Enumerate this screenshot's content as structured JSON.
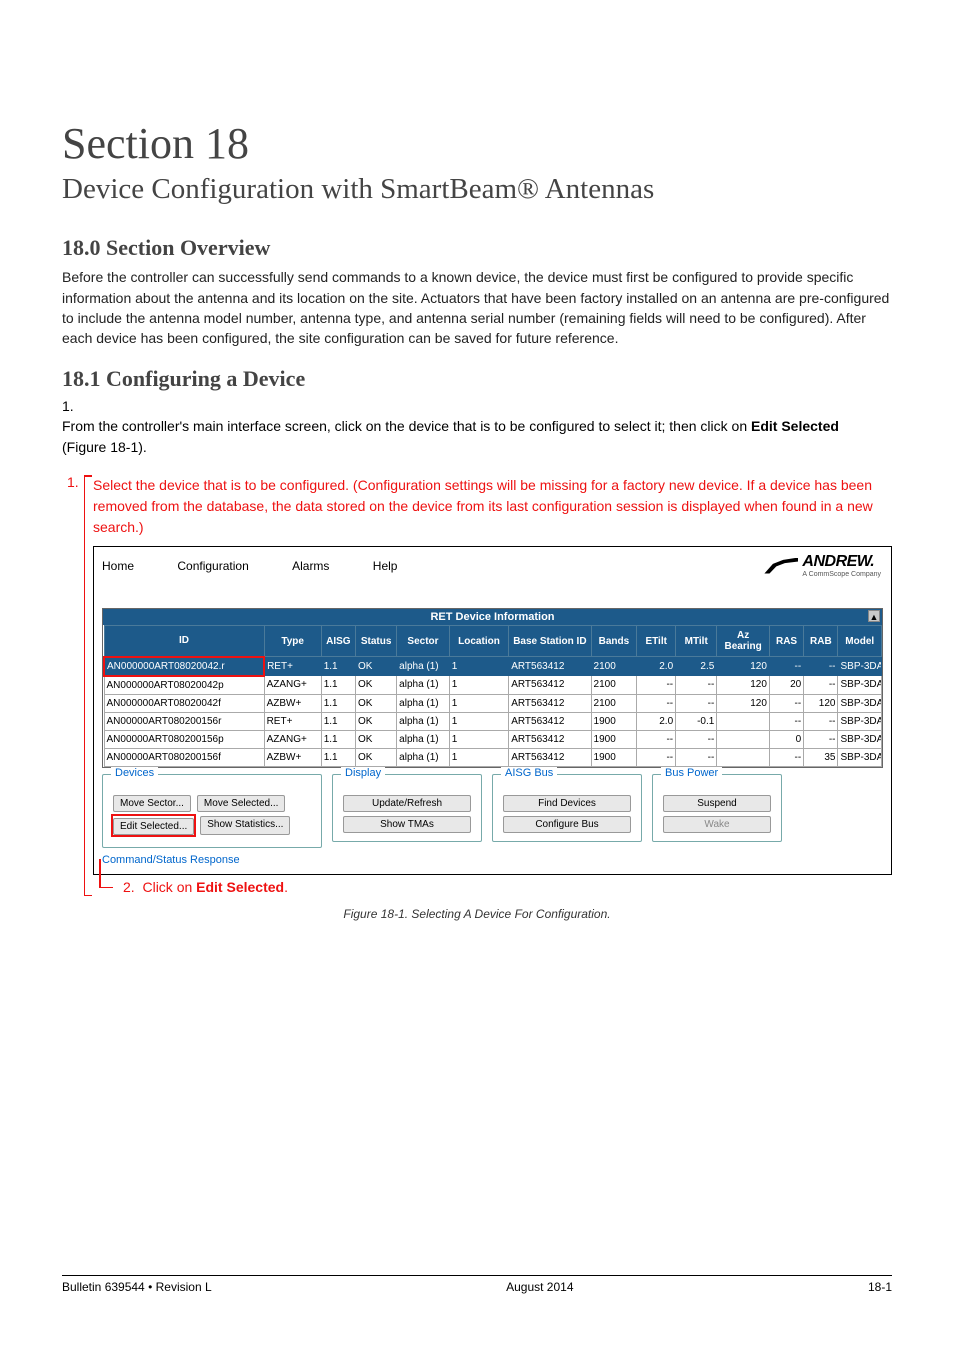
{
  "title": "Section 18",
  "subtitle": "Device Configuration with SmartBeam® Antennas",
  "h_overview": "18.0 Section Overview",
  "p_overview": "Before the controller can successfully send commands to a known device, the device must first be configured to provide specific information about the antenna and its location on the site. Actuators that have been factory installed on an antenna are pre-configured to include the antenna model number, antenna type, and antenna serial number (remaining fields will need to be configured). After each device has been configured, the site configuration can be saved for future reference.",
  "h_config": "18.1 Configuring a Device",
  "step1_num": "1.",
  "step1_a": "From the controller's main interface screen, click on the device that is to be configured to select it; then click on ",
  "step1_bold": "Edit Selected",
  "step1_b": " (Figure 18-1).",
  "annot1_num": "1.",
  "annot1": "Select the device that is to be configured. (Configuration settings will be missing for a factory new device. If a device has been removed from the database, the data stored on the device from its last configuration session is displayed when found in a new search.)",
  "menu": {
    "home": "Home",
    "config": "Configuration",
    "alarms": "Alarms",
    "help": "Help"
  },
  "logo": "ANDREW.",
  "logo_sub": "A CommScope Company",
  "table_title": "RET Device Information",
  "cols": {
    "id": "ID",
    "type": "Type",
    "aisg": "AISG",
    "status": "Status",
    "sector": "Sector",
    "location": "Location",
    "base": "Base Station ID",
    "bands": "Bands",
    "etilt": "ETilt",
    "mtilt": "MTilt",
    "az": "Az Bearing",
    "ras": "RAS",
    "rab": "RAB",
    "model": "Model"
  },
  "rows": [
    {
      "id": "AN000000ART08020042.r",
      "type": "RET+",
      "aisg": "1.1",
      "status": "OK",
      "sector": "alpha (1)",
      "location": "1",
      "base": "ART563412",
      "bands": "2100",
      "etilt": "2.0",
      "mtilt": "2.5",
      "az": "120",
      "ras": "--",
      "rab": "--",
      "model": "SBP-3DA"
    },
    {
      "id": "AN000000ART08020042p",
      "type": "AZANG+",
      "aisg": "1.1",
      "status": "OK",
      "sector": "alpha (1)",
      "location": "1",
      "base": "ART563412",
      "bands": "2100",
      "etilt": "--",
      "mtilt": "--",
      "az": "120",
      "ras": "20",
      "rab": "--",
      "model": "SBP-3DA"
    },
    {
      "id": "AN000000ART08020042f",
      "type": "AZBW+",
      "aisg": "1.1",
      "status": "OK",
      "sector": "alpha (1)",
      "location": "1",
      "base": "ART563412",
      "bands": "2100",
      "etilt": "--",
      "mtilt": "--",
      "az": "120",
      "ras": "--",
      "rab": "120",
      "model": "SBP-3DA"
    },
    {
      "id": "AN00000ART080200156r",
      "type": "RET+",
      "aisg": "1.1",
      "status": "OK",
      "sector": "alpha (1)",
      "location": "1",
      "base": "ART563412",
      "bands": "1900",
      "etilt": "2.0",
      "mtilt": "-0.1",
      "az": "",
      "ras": "--",
      "rab": "--",
      "model": "SBP-3DA"
    },
    {
      "id": "AN00000ART080200156p",
      "type": "AZANG+",
      "aisg": "1.1",
      "status": "OK",
      "sector": "alpha (1)",
      "location": "1",
      "base": "ART563412",
      "bands": "1900",
      "etilt": "--",
      "mtilt": "--",
      "az": "",
      "ras": "0",
      "rab": "--",
      "model": "SBP-3DA"
    },
    {
      "id": "AN00000ART080200156f",
      "type": "AZBW+",
      "aisg": "1.1",
      "status": "OK",
      "sector": "alpha (1)",
      "location": "1",
      "base": "ART563412",
      "bands": "1900",
      "etilt": "--",
      "mtilt": "--",
      "az": "",
      "ras": "--",
      "rab": "35",
      "model": "SBP-3DA"
    }
  ],
  "panes": {
    "devices": "Devices",
    "display": "Display",
    "aisg": "AISG Bus",
    "bus": "Bus Power",
    "move_sector": "Move Sector...",
    "move_selected": "Move Selected...",
    "edit_selected": "Edit Selected...",
    "show_stats": "Show Statistics...",
    "update": "Update/Refresh",
    "show_tmas": "Show TMAs",
    "find": "Find Devices",
    "config_bus": "Configure Bus",
    "suspend": "Suspend",
    "wake": "Wake"
  },
  "cmd": "Command/Status Response",
  "annot2_num": "2.",
  "annot2_a": "Click on ",
  "annot2_bold": "Edit Selected",
  "annot2_b": ".",
  "figcap": "Figure 18-1.  Selecting A Device For Configuration.",
  "footer": {
    "left": "Bulletin 639544  •  Revision L",
    "center": "August 2014",
    "right": "18-1"
  }
}
